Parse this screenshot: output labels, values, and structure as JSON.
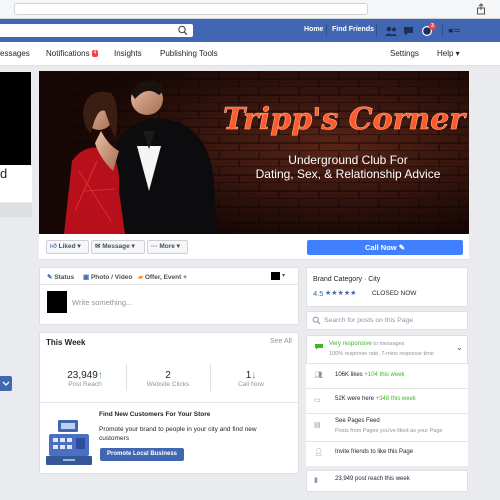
{
  "top_bar": {
    "links": [
      "Home",
      "Find Friends"
    ],
    "badges": {
      "messages": "",
      "notifications": "3"
    }
  },
  "page_nav": {
    "items": [
      "essages",
      "Notifications",
      "Insights",
      "Publishing Tools",
      "Settings",
      "Help"
    ],
    "notifications_badge": "4"
  },
  "left_panel": {
    "fragment": "d"
  },
  "cover": {
    "title": "Tripp's Corner",
    "line1": "Underground Club For",
    "line2": "Dating, Sex, & Relationship Advice",
    "colors": {
      "neon": "#ff5a2a",
      "brick": "#4a1a10"
    }
  },
  "actions": {
    "liked": "Liked",
    "message": "Message",
    "more": "More",
    "call_now": "Call Now"
  },
  "composer": {
    "status": "Status",
    "photo_video": "Photo / Video",
    "offer_event": "Offer, Event +",
    "placeholder": "Write something..."
  },
  "this_week": {
    "title": "This Week",
    "see_all": "See All",
    "stats": [
      {
        "value": "23,949",
        "arrow": "↑",
        "label": "Post Reach"
      },
      {
        "value": "2",
        "arrow": "",
        "label": "Website Clicks"
      },
      {
        "value": "1",
        "arrow": "↓",
        "label": "Call Now"
      }
    ],
    "promo": {
      "title": "Find New Customers For Your Store",
      "body": "Promote your brand to people in your city and find new customers",
      "button": "Promote Local Business"
    }
  },
  "right_panel": {
    "category": "Brand Category · City",
    "rating": "4.5",
    "stars": "★★★★★",
    "status": "CLOSED NOW",
    "search_placeholder": "Search for posts on this Page",
    "responsive_title": "Very responsive",
    "responsive_title_rest": " to messages",
    "responsive_sub": "100% response rate, 7-mins response time",
    "likes": "106K likes",
    "likes_delta": " +104 this week",
    "were_here": "52K were here",
    "were_here_delta": " +348 this week",
    "feed_title": "See Pages Feed",
    "feed_sub": "Posts from Pages you've liked as your Page",
    "invite": "Invite friends to like this Page",
    "reach": "23,949 post reach this week"
  }
}
